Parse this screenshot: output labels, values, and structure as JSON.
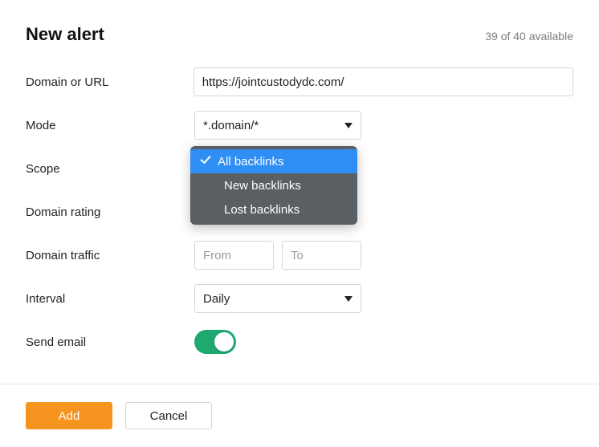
{
  "header": {
    "title": "New alert",
    "available": "39 of 40 available"
  },
  "labels": {
    "domain_or_url": "Domain or URL",
    "mode": "Mode",
    "scope": "Scope",
    "domain_rating": "Domain rating",
    "domain_traffic": "Domain traffic",
    "interval": "Interval",
    "send_email": "Send email"
  },
  "fields": {
    "url_value": "https://jointcustodydc.com/",
    "mode_value": "*.domain/*",
    "interval_value": "Daily",
    "range_from_placeholder": "From",
    "range_to_placeholder": "To"
  },
  "scope_dropdown": {
    "options": [
      "All backlinks",
      "New backlinks",
      "Lost backlinks"
    ],
    "selected_index": 0
  },
  "send_email_on": true,
  "footer": {
    "add": "Add",
    "cancel": "Cancel"
  }
}
